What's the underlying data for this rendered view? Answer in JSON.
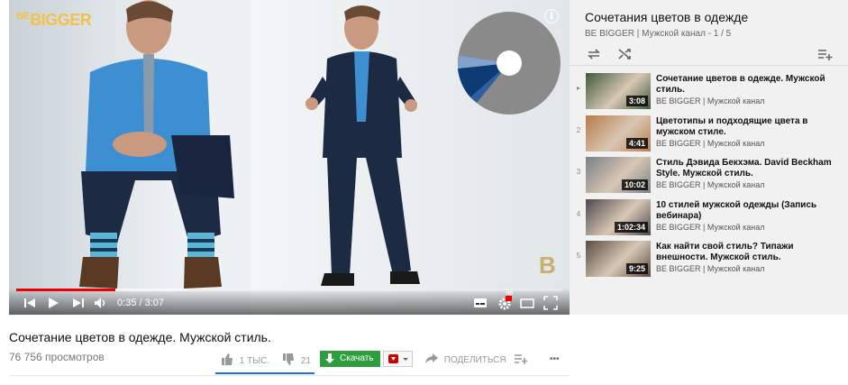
{
  "player": {
    "channel_logo_prefix": "BE",
    "channel_logo_main": "BIGGER",
    "corner_logo": "B",
    "info_glyph": "i",
    "time_display": "0:35 / 3:07",
    "progress": {
      "played_fraction": 0.182,
      "buffered_fraction": 0.314
    },
    "hd_badge": "HD",
    "pie_colors": [
      "#8a8a8a",
      "#0d3b73",
      "#2f5fa3",
      "#7fa2cf",
      "#ffffff"
    ]
  },
  "playlist": {
    "title": "Сочетания цветов в одежде",
    "subtitle": "BE BIGGER | Мужской канал - 1 / 5",
    "items": [
      {
        "index": "▸",
        "title": "Сочетание цветов в одежде. Мужской стиль.",
        "channel": "BE BIGGER | Мужской канал",
        "duration": "3:08",
        "thumb_color": "#3f5a3a"
      },
      {
        "index": "2",
        "title": "Цветотипы и подходящие цвета в мужском стиле.",
        "channel": "BE BIGGER | Мужской канал",
        "duration": "4:41",
        "thumb_color": "#b87a4b"
      },
      {
        "index": "3",
        "title": "Стиль Дэвида Бекхэма. David Beckham Style. Мужской стиль.",
        "channel": "BE BIGGER | Мужской канал",
        "duration": "10:02",
        "thumb_color": "#7a7f85"
      },
      {
        "index": "4",
        "title": "10 стилей мужской одежды (Запись вебинара)",
        "channel": "BE BIGGER | Мужской канал",
        "duration": "1:02:34",
        "thumb_color": "#4c4a4e"
      },
      {
        "index": "5",
        "title": "Как найти свой стиль? Типажи внешности. Мужской стиль.",
        "channel": "BE BIGGER | Мужской канал",
        "duration": "9:25",
        "thumb_color": "#5a4b43"
      }
    ]
  },
  "video": {
    "title": "Сочетание цветов в одежде. Мужской стиль.",
    "views": "76 756 просмотров",
    "likes": "1 ТЫС.",
    "dislikes": "21",
    "download_label": "Скачать",
    "share_label": "ПОДЕЛИТЬСЯ",
    "more_label": "•••"
  },
  "colors": {
    "progress_played": "#ee0000",
    "download_green": "#2e9d3e",
    "like_underline": "#1a73e8"
  }
}
